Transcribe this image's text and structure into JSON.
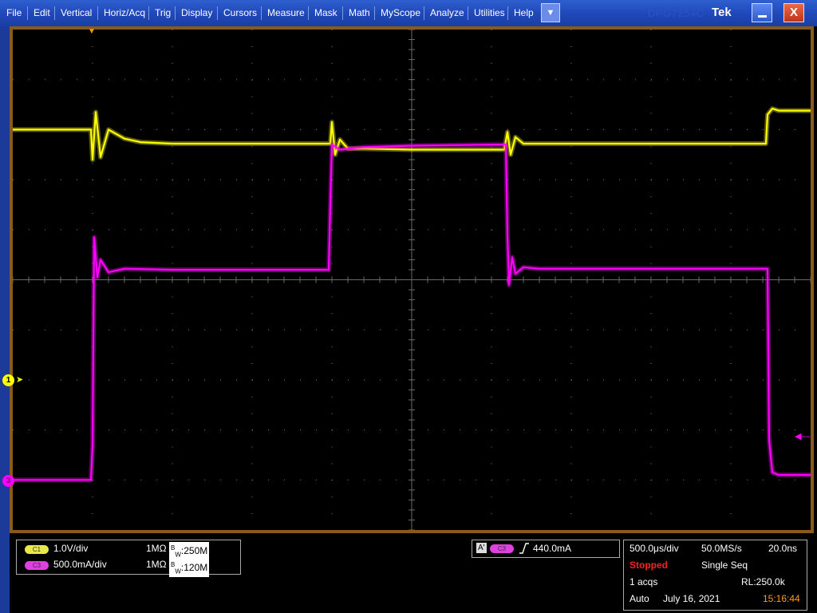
{
  "menu": {
    "items": [
      "File",
      "Edit",
      "Vertical",
      "Horiz/Acq",
      "Trig",
      "Display",
      "Cursors",
      "Measure",
      "Mask",
      "Math",
      "MyScope",
      "Analyze",
      "Utilities",
      "Help"
    ],
    "dropdown_icon": "chevron-down-icon",
    "brand_ghost": "DPO7254C",
    "brand": "Tek",
    "minimize_icon": "minimize-icon",
    "close_label": "X"
  },
  "markers": {
    "c1_ground": "1",
    "c3_ground": "3",
    "trigger_position_icon": "triangle-down-icon",
    "trigger_level_icon": "arrow-left-icon"
  },
  "channels": [
    {
      "badge": "C1",
      "scale": "1.0V/div",
      "impedance": "1MΩ",
      "bw_label": "250M",
      "color": "#e8e84a"
    },
    {
      "badge": "C3",
      "scale": "500.0mA/div",
      "impedance": "1MΩ",
      "bw_label": "120M",
      "color": "#e040e0"
    }
  ],
  "trigger": {
    "mode_badge": "A'",
    "source_badge": "C3",
    "slope_icon": "rising-edge-icon",
    "level": "440.0mA"
  },
  "horizontal": {
    "scale": "500.0μs/div",
    "sample_rate": "50.0MS/s",
    "resolution": "20.0ns",
    "status": "Stopped",
    "acq_mode": "Single Seq",
    "acqs": "1 acqs",
    "record_length": "RL:250.0k",
    "trigger_mode": "Auto",
    "date": "July 16, 2021",
    "time": "15:16:44"
  },
  "colors": {
    "ch1": "#ffff00",
    "ch3": "#ff00ff",
    "status": "#ff2020",
    "time": "#ff9a20",
    "menubar": "#1f47b8"
  },
  "chart_data": {
    "type": "line",
    "title": "",
    "xlabel": "",
    "ylabel": "",
    "x_unit": "ms",
    "xlim": [
      0,
      5
    ],
    "ylim": [
      -5,
      5
    ],
    "grid": true,
    "series": [
      {
        "x": [
          0,
          0.49,
          0.5,
          0.52,
          0.55,
          0.6,
          0.7,
          0.8,
          1.0,
          1.5,
          1.99,
          2.0,
          2.02,
          2.05,
          2.1,
          2.2,
          2.5,
          3.08,
          3.1,
          3.12,
          3.15,
          3.2,
          3.3,
          3.5,
          4.0,
          4.72,
          4.73,
          4.76,
          4.8,
          5.0
        ],
        "y": [
          3.0,
          3.0,
          2.4,
          3.35,
          2.45,
          3.0,
          2.82,
          2.75,
          2.72,
          2.72,
          2.72,
          3.15,
          2.5,
          2.8,
          2.62,
          2.62,
          2.6,
          2.6,
          2.95,
          2.5,
          2.85,
          2.72,
          2.72,
          2.72,
          2.72,
          2.72,
          3.3,
          3.42,
          3.38,
          3.38
        ]
      },
      {
        "x": [
          0,
          0.49,
          0.5,
          0.51,
          0.53,
          0.55,
          0.6,
          0.7,
          1.0,
          1.5,
          1.98,
          1.99,
          2.0,
          2.05,
          2.2,
          2.5,
          3.0,
          3.09,
          3.1,
          3.11,
          3.13,
          3.15,
          3.2,
          3.3,
          3.5,
          4.0,
          4.73,
          4.74,
          4.76,
          4.8,
          5.0
        ],
        "y": [
          -4.0,
          -4.0,
          -3.3,
          0.85,
          0.05,
          0.4,
          0.15,
          0.22,
          0.2,
          0.2,
          0.2,
          1.5,
          2.7,
          2.6,
          2.65,
          2.68,
          2.7,
          2.7,
          0.9,
          -0.1,
          0.45,
          0.12,
          0.25,
          0.22,
          0.22,
          0.22,
          0.22,
          -3.2,
          -3.85,
          -3.9,
          -3.9
        ]
      }
    ]
  }
}
